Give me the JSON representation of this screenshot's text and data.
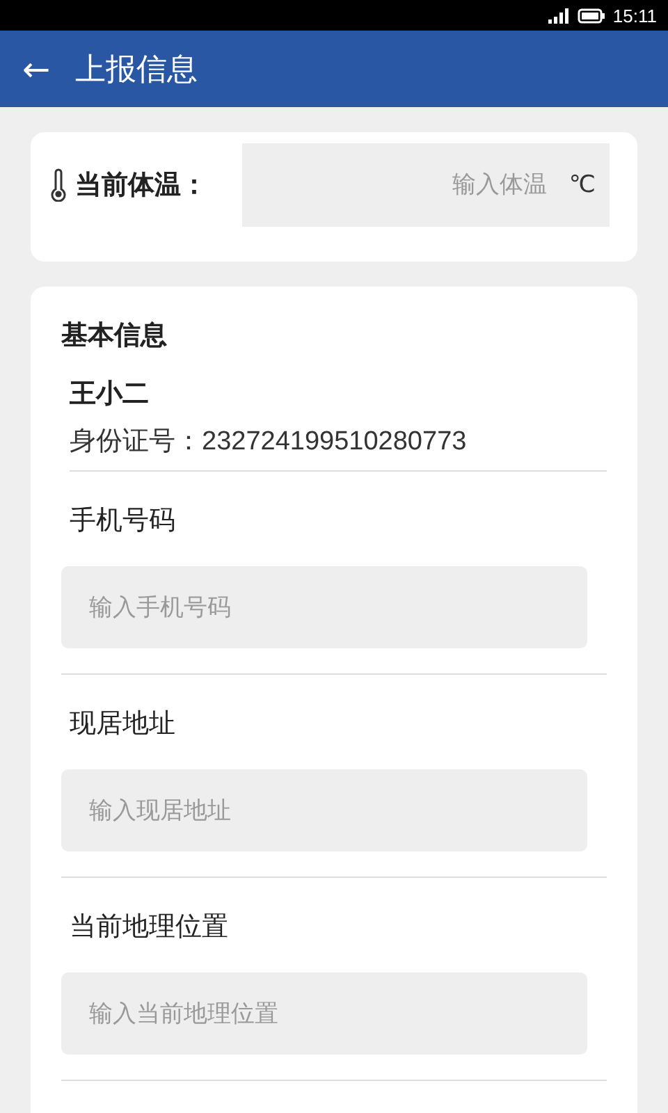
{
  "status_bar": {
    "time": "15:11"
  },
  "header": {
    "back": "←",
    "title": "上报信息"
  },
  "temperature": {
    "label": "当前体温：",
    "placeholder": "输入体温",
    "unit": "℃"
  },
  "basic_info": {
    "title": "基本信息",
    "name": "王小二",
    "id_label": "身份证号：",
    "id_number": "232724199510280773",
    "fields": [
      {
        "label": "手机号码",
        "placeholder": "输入手机号码"
      },
      {
        "label": "现居地址",
        "placeholder": "输入现居地址"
      },
      {
        "label": "当前地理位置",
        "placeholder": "输入当前地理位置"
      }
    ]
  }
}
